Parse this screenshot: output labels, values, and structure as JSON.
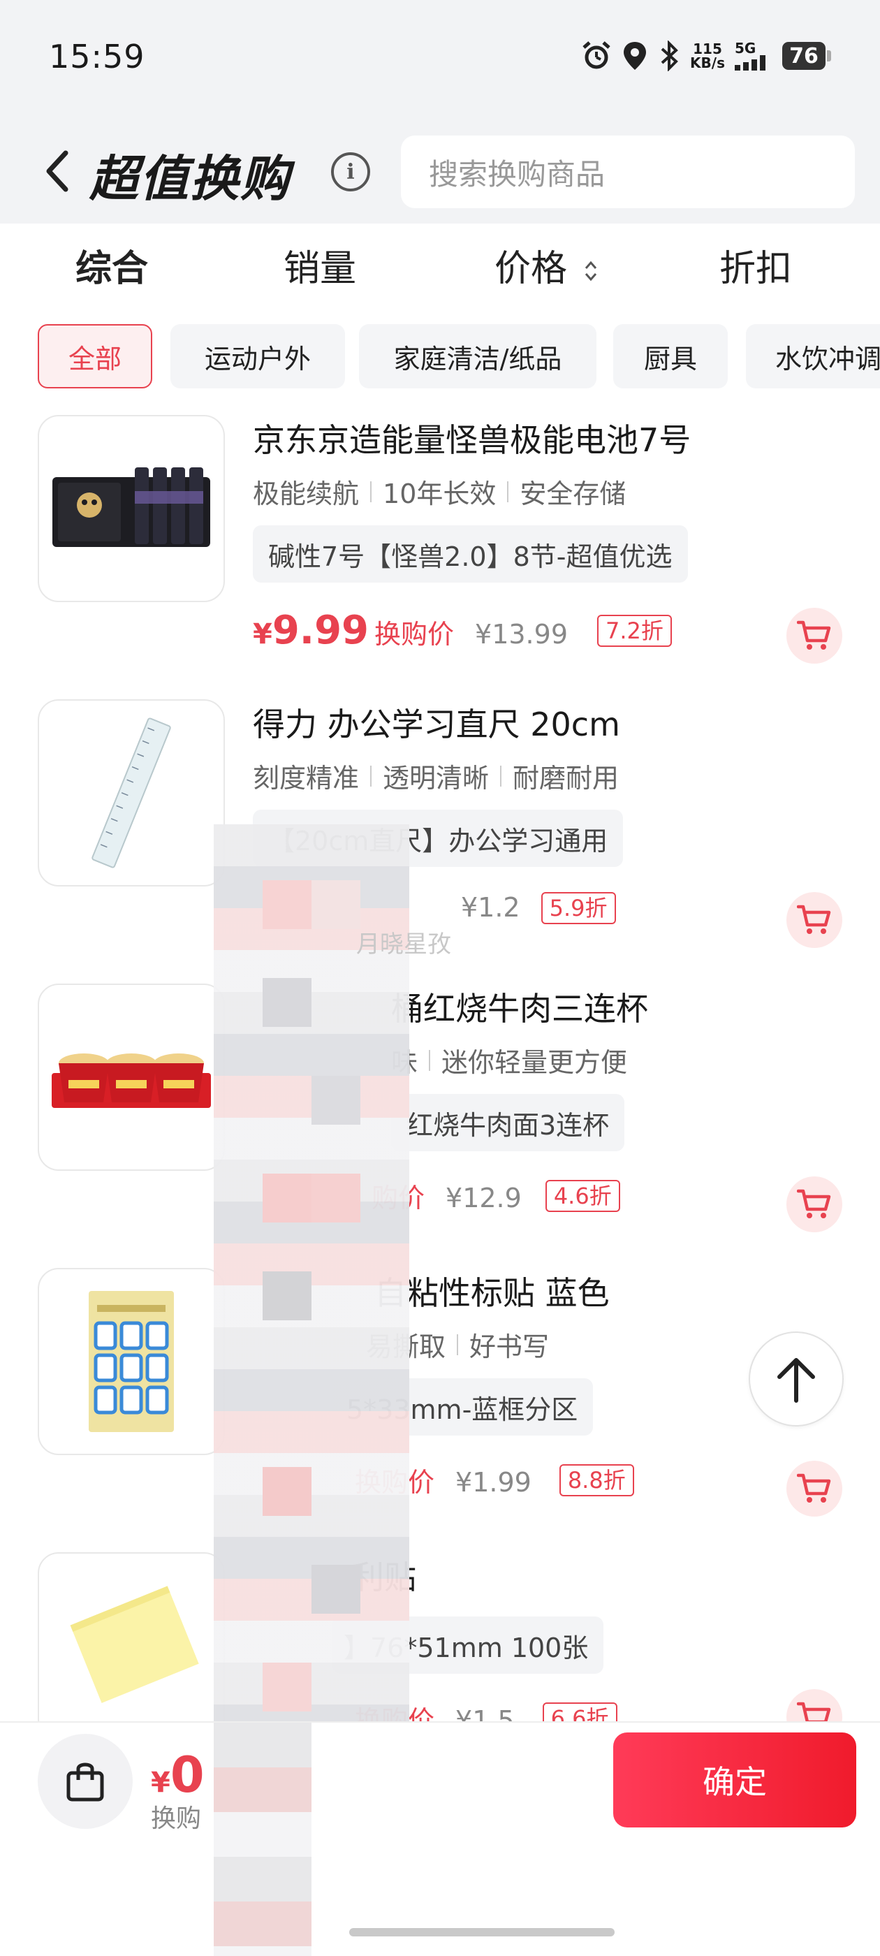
{
  "status_bar": {
    "time": "15:59",
    "net_speed_value": "115",
    "net_speed_unit": "KB/s",
    "network": "5G",
    "battery": "76"
  },
  "header": {
    "title": "超值换购",
    "search_placeholder": "搜索换购商品"
  },
  "sort_tabs": [
    {
      "label": "综合",
      "active": true
    },
    {
      "label": "销量",
      "active": false
    },
    {
      "label": "价格",
      "active": false
    },
    {
      "label": "折扣",
      "active": false
    }
  ],
  "categories": [
    {
      "label": "全部",
      "active": true
    },
    {
      "label": "运动户外",
      "active": false
    },
    {
      "label": "家庭清洁/纸品",
      "active": false
    },
    {
      "label": "厨具",
      "active": false
    },
    {
      "label": "水饮冲调",
      "active": false
    }
  ],
  "products": [
    {
      "name": "京东京造能量怪兽极能电池7号",
      "features": [
        "极能续航",
        "10年长效",
        "安全存储"
      ],
      "spec": "碱性7号【怪兽2.0】8节-超值优选",
      "price_yen": "¥",
      "price": "9.99",
      "price_label": "换购价",
      "original_price": "¥13.99",
      "discount": "7.2折"
    },
    {
      "name": "得力 办公学习直尺 20cm",
      "features": [
        "刻度精准",
        "透明清晰",
        "耐磨耐用"
      ],
      "spec": "【20cm直尺】办公学习通用",
      "price_yen": "",
      "price": "",
      "price_label": "",
      "original_price": "¥1.2",
      "discount": "5.9折"
    },
    {
      "name": "桶红烧牛肉三连杯",
      "features": [
        "味",
        "迷你轻量更方便"
      ],
      "spec": "红烧牛肉面3连杯",
      "price_yen": "",
      "price": "",
      "price_label": "购价",
      "original_price": "¥12.9",
      "discount": "4.6折"
    },
    {
      "name": "自粘性标贴 蓝色",
      "features": [
        "易撕取",
        "好书写"
      ],
      "spec": "5*33mm-蓝框分区",
      "price_yen": "",
      "price": "",
      "price_label": "换购价",
      "original_price": "¥1.99",
      "discount": "8.8折"
    },
    {
      "name": "利贴",
      "features": [],
      "spec": "】76*51mm 100张",
      "price_yen": "",
      "price": "",
      "price_label": "换购价",
      "original_price": "¥1.5",
      "discount": "6.6折"
    }
  ],
  "watermark": "月晓星孜",
  "bottom": {
    "total_yen": "¥",
    "total_value": "0",
    "total_label": "换购",
    "confirm_label": "确定"
  },
  "colors": {
    "accent": "#e8424f",
    "background": "#f2f3f5"
  },
  "icons": [
    "back-arrow-icon",
    "info-icon",
    "alarm-icon",
    "location-icon",
    "bluetooth-icon",
    "signal-icon",
    "battery-icon",
    "sort-arrows-icon",
    "cart-icon",
    "arrow-up-icon",
    "shopping-bag-icon"
  ]
}
